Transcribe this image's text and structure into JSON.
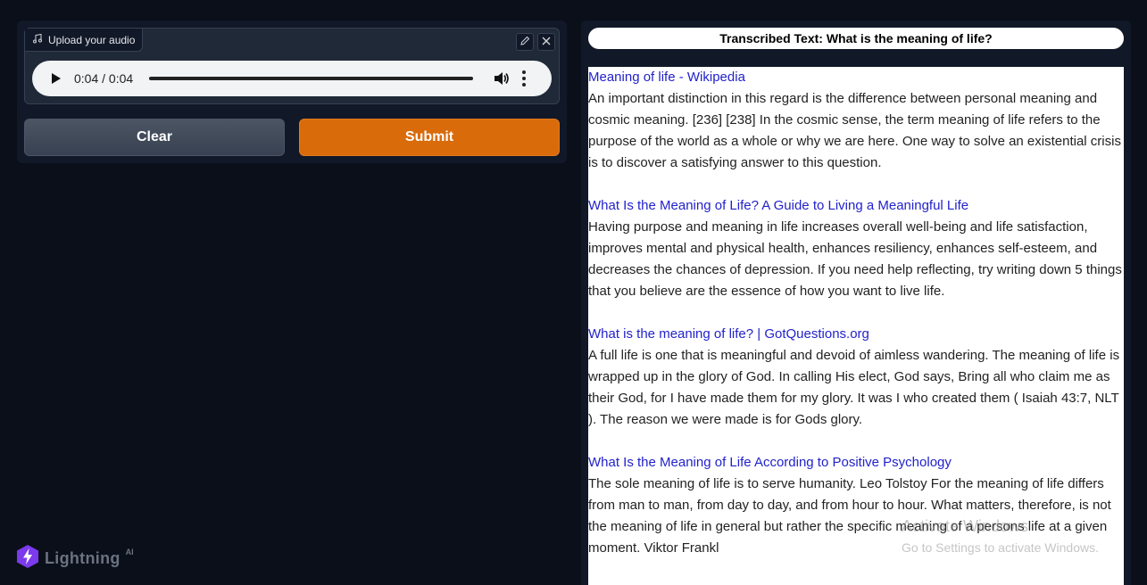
{
  "audio": {
    "label": "Upload your audio",
    "time": "0:04 / 0:04",
    "progress": 1.0
  },
  "buttons": {
    "clear": "Clear",
    "submit": "Submit"
  },
  "logo": {
    "text": "Lightning",
    "superscript": "AI"
  },
  "output": {
    "title": "Transcribed Text: What is the meaning of life?",
    "results": [
      {
        "link": "Meaning of life - Wikipedia",
        "text": "An important distinction in this regard is the difference between personal meaning and cosmic meaning. [236] [238] In the cosmic sense, the term meaning of life refers to the purpose of the world as a whole or why we are here. One way to solve an existential crisis is to discover a satisfying answer to this question."
      },
      {
        "link": "What Is the Meaning of Life? A Guide to Living a Meaningful Life",
        "text": "Having purpose and meaning in life increases overall well-being and life satisfaction, improves mental and physical health, enhances resiliency, enhances self-esteem, and decreases the chances of depression. If you need help reflecting, try writing down 5 things that you believe are the essence of how you want to live life."
      },
      {
        "link": "What is the meaning of life? | GotQuestions.org",
        "text": "A full life is one that is meaningful and devoid of aimless wandering. The meaning of life is wrapped up in the glory of God. In calling His elect, God says, Bring all who claim me as their God, for I have made them for my glory. It was I who created them ( Isaiah 43:7, NLT ). The reason we were made is for Gods glory."
      },
      {
        "link": "What Is the Meaning of Life According to Positive Psychology",
        "text": "The sole meaning of life is to serve humanity. Leo Tolstoy For the meaning of life differs from man to man, from day to day, and from hour to hour. What matters, therefore, is not the meaning of life in general but rather the specific meaning of a persons life at a given moment. Viktor Frankl"
      }
    ]
  },
  "watermark": {
    "line1": "Activate Windows",
    "line2": "Go to Settings to activate Windows."
  },
  "colors": {
    "background": "#0b0f19",
    "panel": "#111827",
    "submit": "#d96b0b",
    "link": "#2222cc"
  }
}
